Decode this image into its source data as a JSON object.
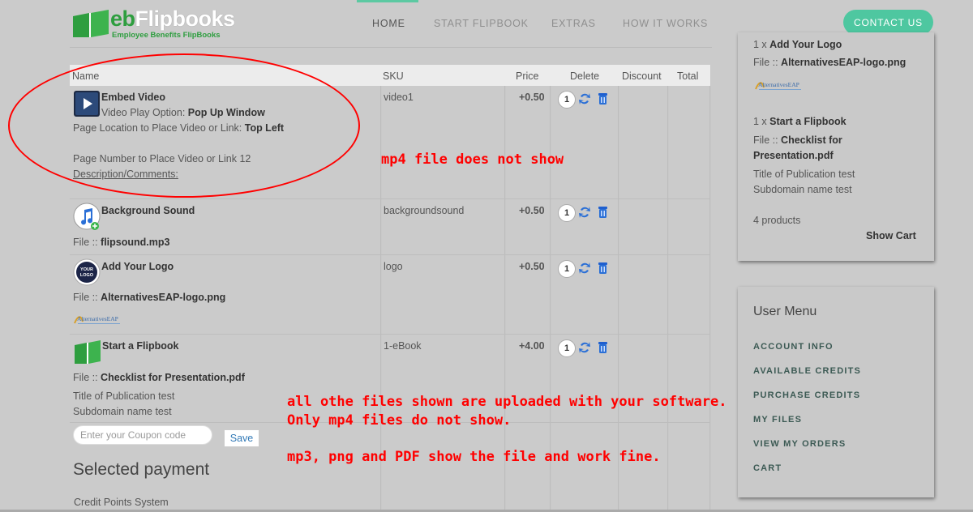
{
  "brand": {
    "logo_eb": "eb",
    "logo_flipbooks": "Flipbooks",
    "logo_subtitle": "Employee Benefits FlipBooks",
    "accent": "#4ec7a0",
    "logo_green": "#2e9e3f"
  },
  "nav": {
    "items": [
      "HOME",
      "START FLIPBOOK",
      "EXTRAS",
      "HOW IT WORKS"
    ],
    "active": "HOME",
    "contact": "CONTACT US"
  },
  "table": {
    "headers": [
      "Name",
      "SKU",
      "Price",
      "Delete",
      "Discount",
      "Total"
    ],
    "rows": [
      {
        "title": "Embed Video",
        "icon": "video-play-icon",
        "option_label": "Video Play Option:",
        "option_value": "Pop Up Window",
        "location_label": "Page Location to Place Video or Link:",
        "location_value": "Top Left",
        "page_number": "Page Number to Place Video or Link 12",
        "comments": "Description/Comments:",
        "sku": "video1",
        "price": "+0.50",
        "qty": "1"
      },
      {
        "title": "Background Sound",
        "icon": "music-note-icon",
        "file_label": "File ::",
        "file_value": "flipsound.mp3",
        "sku": "backgroundsound",
        "price": "+0.50",
        "qty": "1"
      },
      {
        "title": "Add Your Logo",
        "icon": "your-logo-icon",
        "icon_text": "YOUR LOGO",
        "file_label": "File ::",
        "file_value": "AlternativesEAP-logo.png",
        "thumb_text": "AlternativesEAP",
        "sku": "logo",
        "price": "+0.50",
        "qty": "1"
      },
      {
        "title": "Start a Flipbook",
        "icon": "flipbook-icon",
        "file_label": "File ::",
        "file_value": "Checklist for Presentation.pdf",
        "publication": "Title of Publication test",
        "subdomain": "Subdomain name test",
        "sku": "1-eBook",
        "price": "+4.00",
        "qty": "1"
      }
    ]
  },
  "coupon": {
    "placeholder": "Enter your Coupon code",
    "save": "Save"
  },
  "payment": {
    "title": "Selected payment",
    "method": "Credit Points System"
  },
  "mini_cart": {
    "line1_qty": "1 x",
    "line1_title": "Add Your Logo",
    "line1_file_label": "File ::",
    "line1_file": "AlternativesEAP-logo.png",
    "thumb_text": "AlternativesEAP",
    "line2_qty": "1 x",
    "line2_title": "Start a Flipbook",
    "line2_file_label": "File ::",
    "line2_file_a": "Checklist for",
    "line2_file_b": "Presentation.pdf",
    "publication": "Title of Publication test",
    "subdomain": "Subdomain name test",
    "count": "4 products",
    "show_cart": "Show Cart"
  },
  "user_menu": {
    "title": "User Menu",
    "items": [
      "ACCOUNT INFO",
      "AVAILABLE CREDITS",
      "PURCHASE CREDITS",
      "MY FILES",
      "VIEW MY ORDERS",
      "CART"
    ]
  },
  "annotations": {
    "mp4_note": "mp4 file does not show",
    "line1": "all othe files shown are uploaded with your software.",
    "line2": "Only mp4 files do not show.",
    "line3": "mp3, png and PDF show the file and work fine.",
    "color": "#ff0000"
  }
}
